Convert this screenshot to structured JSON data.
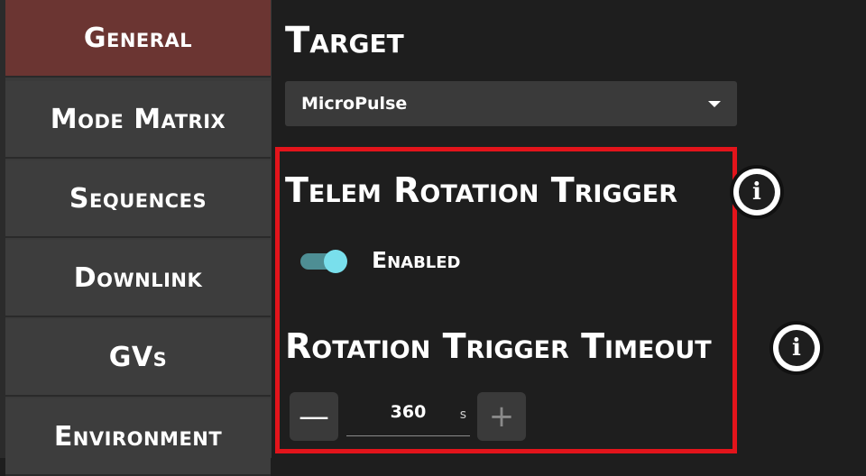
{
  "sidebar": {
    "items": [
      {
        "label": "General",
        "active": true
      },
      {
        "label": "Mode Matrix",
        "active": false
      },
      {
        "label": "Sequences",
        "active": false
      },
      {
        "label": "Downlink",
        "active": false
      },
      {
        "label": "GVs",
        "active": false
      },
      {
        "label": "Environment",
        "active": false
      }
    ]
  },
  "target": {
    "title": "Target",
    "selected": "MicroPulse"
  },
  "telem_rotation_trigger": {
    "title": "Telem Rotation Trigger",
    "toggle_label": "Enabled",
    "enabled": true
  },
  "rotation_trigger_timeout": {
    "title": "Rotation Trigger Timeout",
    "value": "360",
    "unit": "s"
  },
  "icons": {
    "info": "info-icon",
    "dropdown": "chevron-down-icon",
    "minus": "minus-icon",
    "plus": "plus-icon"
  },
  "colors": {
    "active_nav": "#6b3532",
    "highlight_border": "#e3141b",
    "toggle_thumb": "#79dfec",
    "toggle_track": "#4e8e94"
  }
}
